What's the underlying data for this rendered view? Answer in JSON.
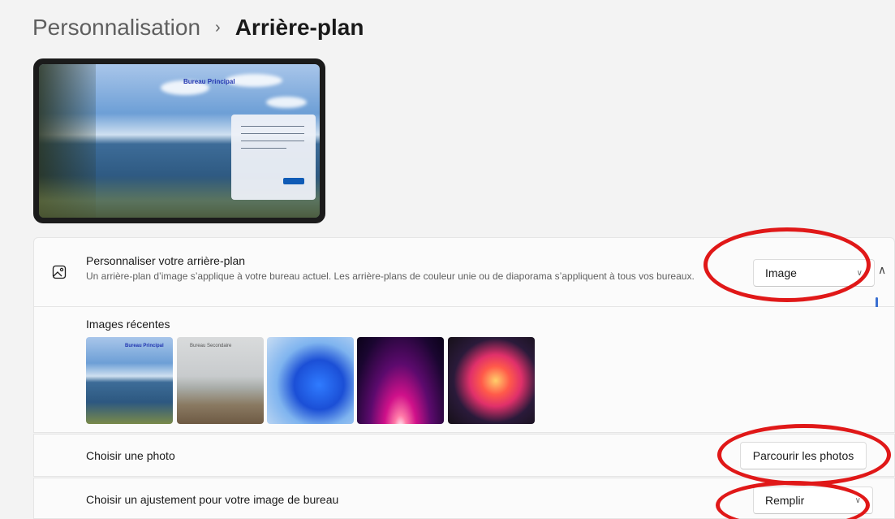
{
  "header": {
    "parent": "Personnalisation",
    "separator": "›",
    "current": "Arrière-plan"
  },
  "preview": {
    "caption": "Bureau Principal"
  },
  "background_setting": {
    "icon": "image-icon",
    "title": "Personnaliser votre arrière-plan",
    "description": "Un arrière-plan d’image s’applique à votre bureau actuel. Les arrière-plans de couleur unie ou de diaporama s’appliquent à tous vos bureaux.",
    "type_value": "Image"
  },
  "recent": {
    "title": "Images récentes",
    "thumbs": [
      {
        "caption": "Bureau Principal"
      },
      {
        "caption": "Bureau Secondaire"
      },
      {
        "caption": ""
      },
      {
        "caption": ""
      },
      {
        "caption": ""
      }
    ]
  },
  "photo": {
    "label": "Choisir une photo",
    "button": "Parcourir les photos"
  },
  "fit": {
    "label": "Choisir un ajustement pour votre image de bureau",
    "value": "Remplir"
  },
  "colors": {
    "annotation": "#e01818",
    "accent": "#0f5bb6"
  }
}
